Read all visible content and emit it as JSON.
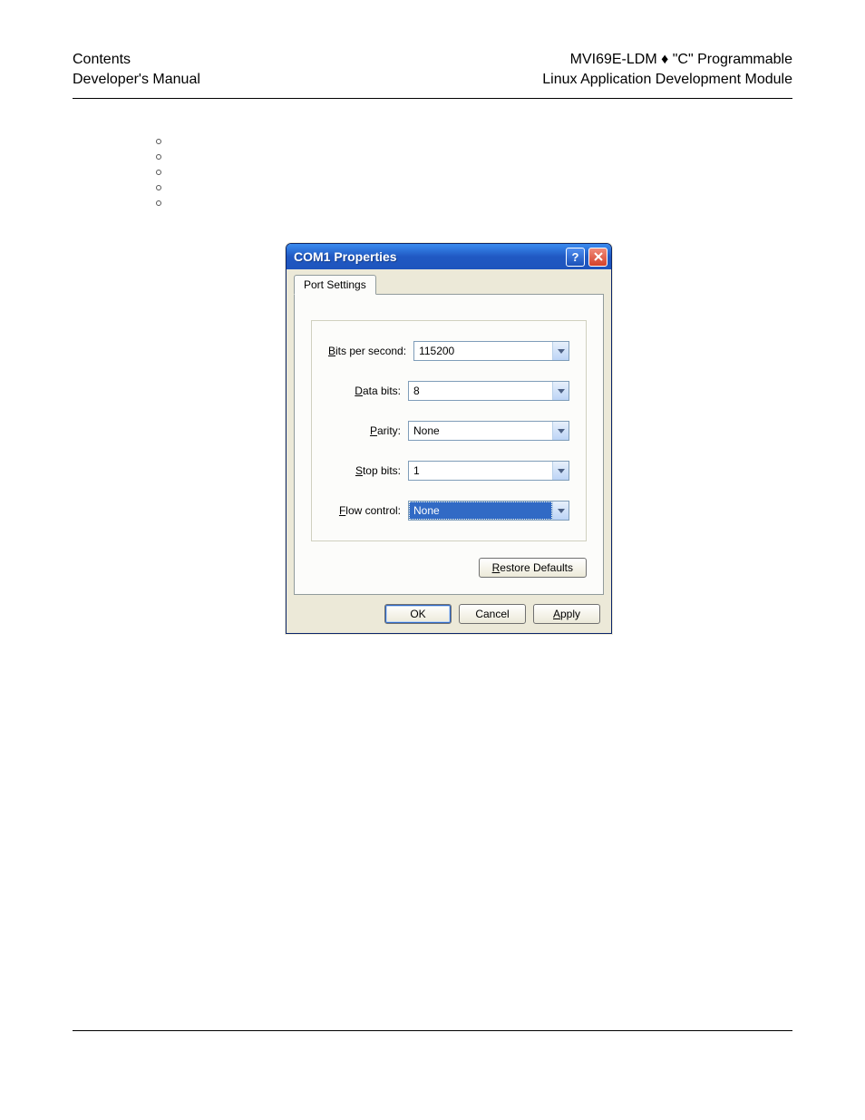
{
  "header": {
    "left_line1": "Contents",
    "left_line2": "Developer's Manual",
    "right_line1": "MVI69E-LDM ♦ \"C\" Programmable",
    "right_line2": "Linux Application Development Module"
  },
  "dialog": {
    "title": "COM1 Properties",
    "tab": "Port Settings",
    "fields": {
      "bits_per_second": {
        "label_pre": "B",
        "label_rest": "its per second:",
        "value": "115200"
      },
      "data_bits": {
        "label_pre": "D",
        "label_rest": "ata bits:",
        "value": "8"
      },
      "parity": {
        "label_pre": "P",
        "label_rest": "arity:",
        "value": "None"
      },
      "stop_bits": {
        "label_pre": "S",
        "label_rest": "top bits:",
        "value": "1"
      },
      "flow_control": {
        "label_pre": "F",
        "label_rest": "low control:",
        "value": "None"
      }
    },
    "buttons": {
      "restore": {
        "pre": "R",
        "rest": "estore Defaults"
      },
      "ok": "OK",
      "cancel": "Cancel",
      "apply": {
        "pre": "A",
        "rest": "pply"
      }
    }
  }
}
